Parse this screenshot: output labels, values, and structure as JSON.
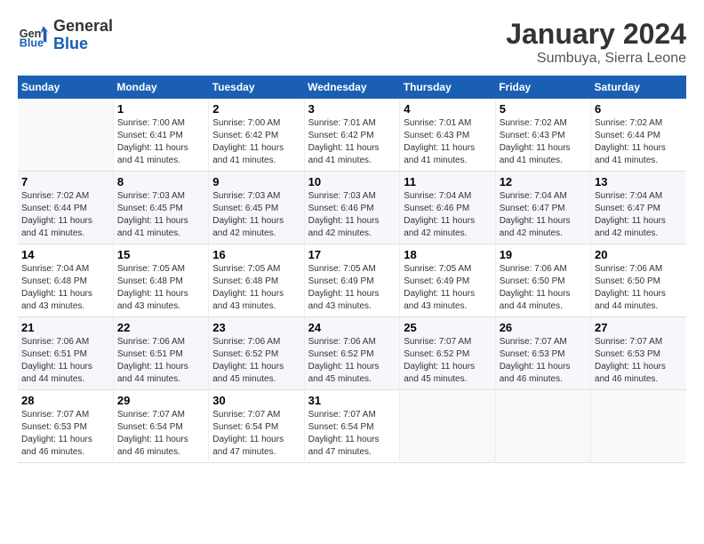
{
  "header": {
    "logo_general": "General",
    "logo_blue": "Blue",
    "month_title": "January 2024",
    "location": "Sumbuya, Sierra Leone"
  },
  "days_of_week": [
    "Sunday",
    "Monday",
    "Tuesday",
    "Wednesday",
    "Thursday",
    "Friday",
    "Saturday"
  ],
  "weeks": [
    [
      {
        "day": "",
        "info": ""
      },
      {
        "day": "1",
        "info": "Sunrise: 7:00 AM\nSunset: 6:41 PM\nDaylight: 11 hours\nand 41 minutes."
      },
      {
        "day": "2",
        "info": "Sunrise: 7:00 AM\nSunset: 6:42 PM\nDaylight: 11 hours\nand 41 minutes."
      },
      {
        "day": "3",
        "info": "Sunrise: 7:01 AM\nSunset: 6:42 PM\nDaylight: 11 hours\nand 41 minutes."
      },
      {
        "day": "4",
        "info": "Sunrise: 7:01 AM\nSunset: 6:43 PM\nDaylight: 11 hours\nand 41 minutes."
      },
      {
        "day": "5",
        "info": "Sunrise: 7:02 AM\nSunset: 6:43 PM\nDaylight: 11 hours\nand 41 minutes."
      },
      {
        "day": "6",
        "info": "Sunrise: 7:02 AM\nSunset: 6:44 PM\nDaylight: 11 hours\nand 41 minutes."
      }
    ],
    [
      {
        "day": "7",
        "info": "Sunrise: 7:02 AM\nSunset: 6:44 PM\nDaylight: 11 hours\nand 41 minutes."
      },
      {
        "day": "8",
        "info": "Sunrise: 7:03 AM\nSunset: 6:45 PM\nDaylight: 11 hours\nand 41 minutes."
      },
      {
        "day": "9",
        "info": "Sunrise: 7:03 AM\nSunset: 6:45 PM\nDaylight: 11 hours\nand 42 minutes."
      },
      {
        "day": "10",
        "info": "Sunrise: 7:03 AM\nSunset: 6:46 PM\nDaylight: 11 hours\nand 42 minutes."
      },
      {
        "day": "11",
        "info": "Sunrise: 7:04 AM\nSunset: 6:46 PM\nDaylight: 11 hours\nand 42 minutes."
      },
      {
        "day": "12",
        "info": "Sunrise: 7:04 AM\nSunset: 6:47 PM\nDaylight: 11 hours\nand 42 minutes."
      },
      {
        "day": "13",
        "info": "Sunrise: 7:04 AM\nSunset: 6:47 PM\nDaylight: 11 hours\nand 42 minutes."
      }
    ],
    [
      {
        "day": "14",
        "info": "Sunrise: 7:04 AM\nSunset: 6:48 PM\nDaylight: 11 hours\nand 43 minutes."
      },
      {
        "day": "15",
        "info": "Sunrise: 7:05 AM\nSunset: 6:48 PM\nDaylight: 11 hours\nand 43 minutes."
      },
      {
        "day": "16",
        "info": "Sunrise: 7:05 AM\nSunset: 6:48 PM\nDaylight: 11 hours\nand 43 minutes."
      },
      {
        "day": "17",
        "info": "Sunrise: 7:05 AM\nSunset: 6:49 PM\nDaylight: 11 hours\nand 43 minutes."
      },
      {
        "day": "18",
        "info": "Sunrise: 7:05 AM\nSunset: 6:49 PM\nDaylight: 11 hours\nand 43 minutes."
      },
      {
        "day": "19",
        "info": "Sunrise: 7:06 AM\nSunset: 6:50 PM\nDaylight: 11 hours\nand 44 minutes."
      },
      {
        "day": "20",
        "info": "Sunrise: 7:06 AM\nSunset: 6:50 PM\nDaylight: 11 hours\nand 44 minutes."
      }
    ],
    [
      {
        "day": "21",
        "info": "Sunrise: 7:06 AM\nSunset: 6:51 PM\nDaylight: 11 hours\nand 44 minutes."
      },
      {
        "day": "22",
        "info": "Sunrise: 7:06 AM\nSunset: 6:51 PM\nDaylight: 11 hours\nand 44 minutes."
      },
      {
        "day": "23",
        "info": "Sunrise: 7:06 AM\nSunset: 6:52 PM\nDaylight: 11 hours\nand 45 minutes."
      },
      {
        "day": "24",
        "info": "Sunrise: 7:06 AM\nSunset: 6:52 PM\nDaylight: 11 hours\nand 45 minutes."
      },
      {
        "day": "25",
        "info": "Sunrise: 7:07 AM\nSunset: 6:52 PM\nDaylight: 11 hours\nand 45 minutes."
      },
      {
        "day": "26",
        "info": "Sunrise: 7:07 AM\nSunset: 6:53 PM\nDaylight: 11 hours\nand 46 minutes."
      },
      {
        "day": "27",
        "info": "Sunrise: 7:07 AM\nSunset: 6:53 PM\nDaylight: 11 hours\nand 46 minutes."
      }
    ],
    [
      {
        "day": "28",
        "info": "Sunrise: 7:07 AM\nSunset: 6:53 PM\nDaylight: 11 hours\nand 46 minutes."
      },
      {
        "day": "29",
        "info": "Sunrise: 7:07 AM\nSunset: 6:54 PM\nDaylight: 11 hours\nand 46 minutes."
      },
      {
        "day": "30",
        "info": "Sunrise: 7:07 AM\nSunset: 6:54 PM\nDaylight: 11 hours\nand 47 minutes."
      },
      {
        "day": "31",
        "info": "Sunrise: 7:07 AM\nSunset: 6:54 PM\nDaylight: 11 hours\nand 47 minutes."
      },
      {
        "day": "",
        "info": ""
      },
      {
        "day": "",
        "info": ""
      },
      {
        "day": "",
        "info": ""
      }
    ]
  ]
}
